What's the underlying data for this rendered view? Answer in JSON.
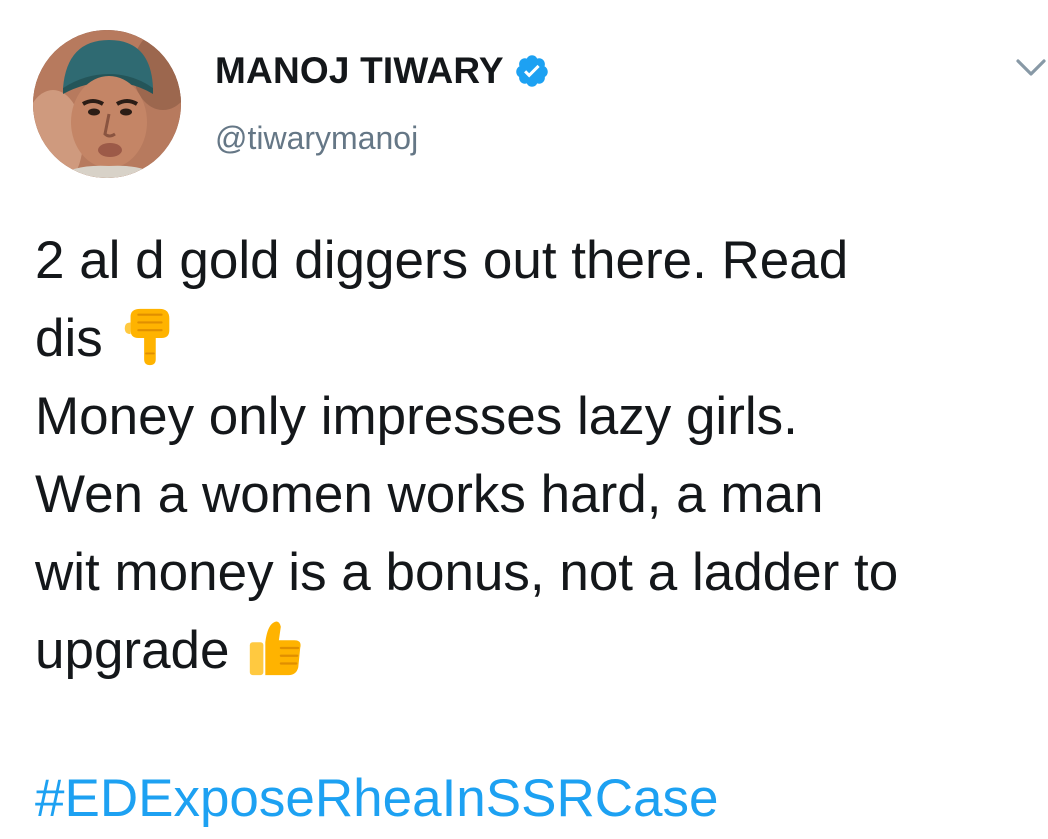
{
  "author": {
    "display_name": "MANOJ TIWARY",
    "handle": "@tiwarymanoj",
    "verified": true,
    "avatar_icon": "profile-photo"
  },
  "tweet": {
    "lines": [
      "2 al d gold diggers out there. Read",
      "dis",
      "Money only impresses lazy girls.",
      "Wen a women works hard, a man",
      "wit money is a bonus, not a ladder to",
      "upgrade"
    ],
    "emojis": {
      "after_dis": "backhand-index-pointing-down",
      "after_upgrade": "thumbs-up"
    },
    "hashtag": "#EDExposeRheaInSSRCase"
  },
  "colors": {
    "text": "#14171a",
    "muted": "#657786",
    "link": "#1da1f2",
    "verified": "#1da1f2"
  }
}
